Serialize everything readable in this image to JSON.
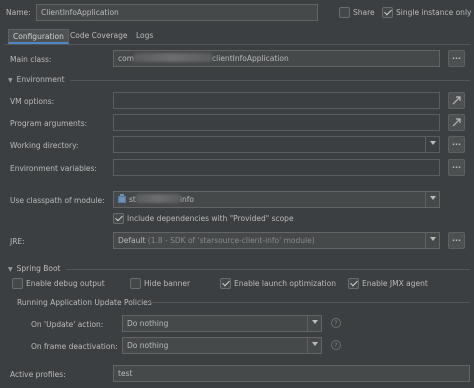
{
  "header": {
    "name_label": "Name:",
    "name_value": "ClientInfoApplication",
    "share_label": "Share",
    "share_checked": false,
    "single_instance_label": "Single instance only",
    "single_instance_checked": true
  },
  "tabs": [
    {
      "label": "Configuration",
      "active": true
    },
    {
      "label": "Code Coverage",
      "active": false
    },
    {
      "label": "Logs",
      "active": false
    }
  ],
  "main_class": {
    "label": "Main class:",
    "value_prefix": "com",
    "value_suffix": "clientInfoApplication",
    "button": "..."
  },
  "environment": {
    "section_title": "Environment",
    "vm_options_label": "VM options:",
    "program_arguments_label": "Program arguments:",
    "working_directory_label": "Working directory:",
    "environment_variables_label": "Environment variables:",
    "classpath_label": "Use classpath of module:",
    "classpath_value_prefix": "st",
    "classpath_value_suffix": "info",
    "include_provided_label": "Include dependencies with \"Provided\" scope",
    "include_provided_checked": true,
    "jre_label": "JRE:",
    "jre_value": "Default",
    "jre_detail": "(1.8 - SDK of 'starsource-client-info' module)",
    "button": "..."
  },
  "spring_boot": {
    "section_title": "Spring Boot",
    "enable_debug_output_label": "Enable debug output",
    "enable_debug_output_checked": false,
    "hide_banner_label": "Hide banner",
    "hide_banner_checked": false,
    "enable_launch_optimization_label": "Enable launch optimization",
    "enable_launch_optimization_checked": true,
    "enable_jmx_agent_label": "Enable JMX agent",
    "enable_jmx_agent_checked": true,
    "update_policies_title": "Running Application Update Policies",
    "on_update_label": "On 'Update' action:",
    "on_update_value": "Do nothing",
    "on_frame_label": "On frame deactivation:",
    "on_frame_value": "Do nothing",
    "help_glyph": "?"
  },
  "active_profiles": {
    "label": "Active profiles:",
    "value": "test"
  }
}
